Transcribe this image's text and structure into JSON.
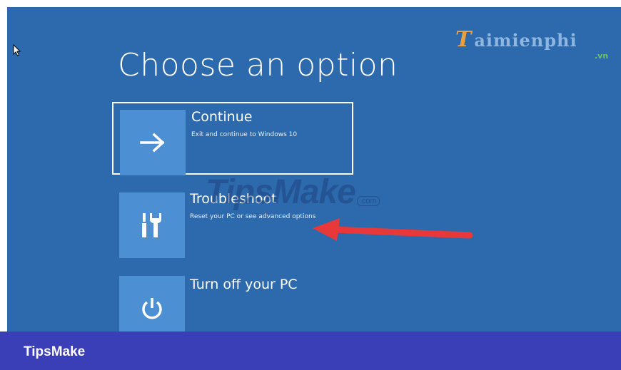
{
  "page_title": "Choose an option",
  "options": [
    {
      "title": "Continue",
      "subtitle": "Exit and continue to Windows 10",
      "icon": "arrow-right-icon"
    },
    {
      "title": "Troubleshoot",
      "subtitle": "Reset your PC or see advanced options",
      "icon": "tools-icon"
    },
    {
      "title": "Turn off your PC",
      "subtitle": "",
      "icon": "power-icon"
    }
  ],
  "logo": {
    "letter": "T",
    "text": "aimienphi",
    "suffix": ".vn"
  },
  "watermark": {
    "main": "TipsMake",
    "suffix": ".com"
  },
  "footer": {
    "brand": "TipsMake"
  },
  "colors": {
    "background": "#2c6aad",
    "tile": "#4c90d3",
    "footer": "#3a3fb8",
    "arrow": "#e8383a"
  }
}
